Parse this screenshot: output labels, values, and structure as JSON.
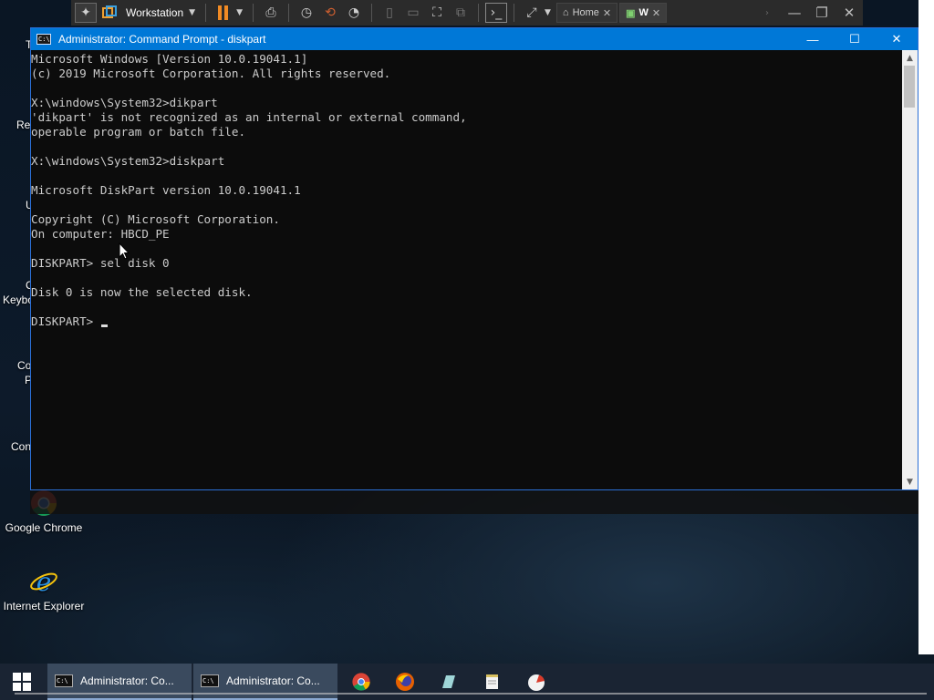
{
  "toolbar": {
    "vm_name": "Workstation",
    "tabs": [
      {
        "label": "Home",
        "active": false
      },
      {
        "label": "W",
        "active": true
      }
    ]
  },
  "cmd": {
    "title": "Administrator: Command Prompt - diskpart",
    "icon_text": "C:\\",
    "lines": [
      "Microsoft Windows [Version 10.0.19041.1]",
      "(c) 2019 Microsoft Corporation. All rights reserved.",
      "",
      "X:\\windows\\System32>dikpart",
      "'dikpart' is not recognized as an internal or external command,",
      "operable program or batch file.",
      "",
      "X:\\windows\\System32>diskpart",
      "",
      "Microsoft DiskPart version 10.0.19041.1",
      "",
      "Copyright (C) Microsoft Corporation.",
      "On computer: HBCD_PE",
      "",
      "DISKPART> sel disk 0",
      "",
      "Disk 0 is now the selected disk.",
      "",
      "DISKPART> "
    ]
  },
  "desktop": {
    "icons": [
      {
        "label": "Google Chrome",
        "icon": "chrome-icon"
      },
      {
        "label": "Internet Explorer",
        "icon": "internet-explorer-icon"
      }
    ],
    "partial_labels": [
      "T",
      "Re",
      "U",
      "C",
      "Keybo",
      "Co",
      "P",
      "Con"
    ]
  },
  "taskbar": {
    "items": [
      {
        "label": "Administrator: Co..."
      },
      {
        "label": "Administrator: Co..."
      }
    ],
    "pinned": [
      "chrome-icon",
      "firefox-icon",
      "pen-icon",
      "notepad-icon",
      "disk-tool-icon"
    ]
  },
  "colors": {
    "title_bar": "#0078d7",
    "console_bg": "#0c0c0c",
    "console_text": "#cccccc",
    "toolbar_bg": "#2b2b2b",
    "pause_orange": "#f08a24"
  }
}
